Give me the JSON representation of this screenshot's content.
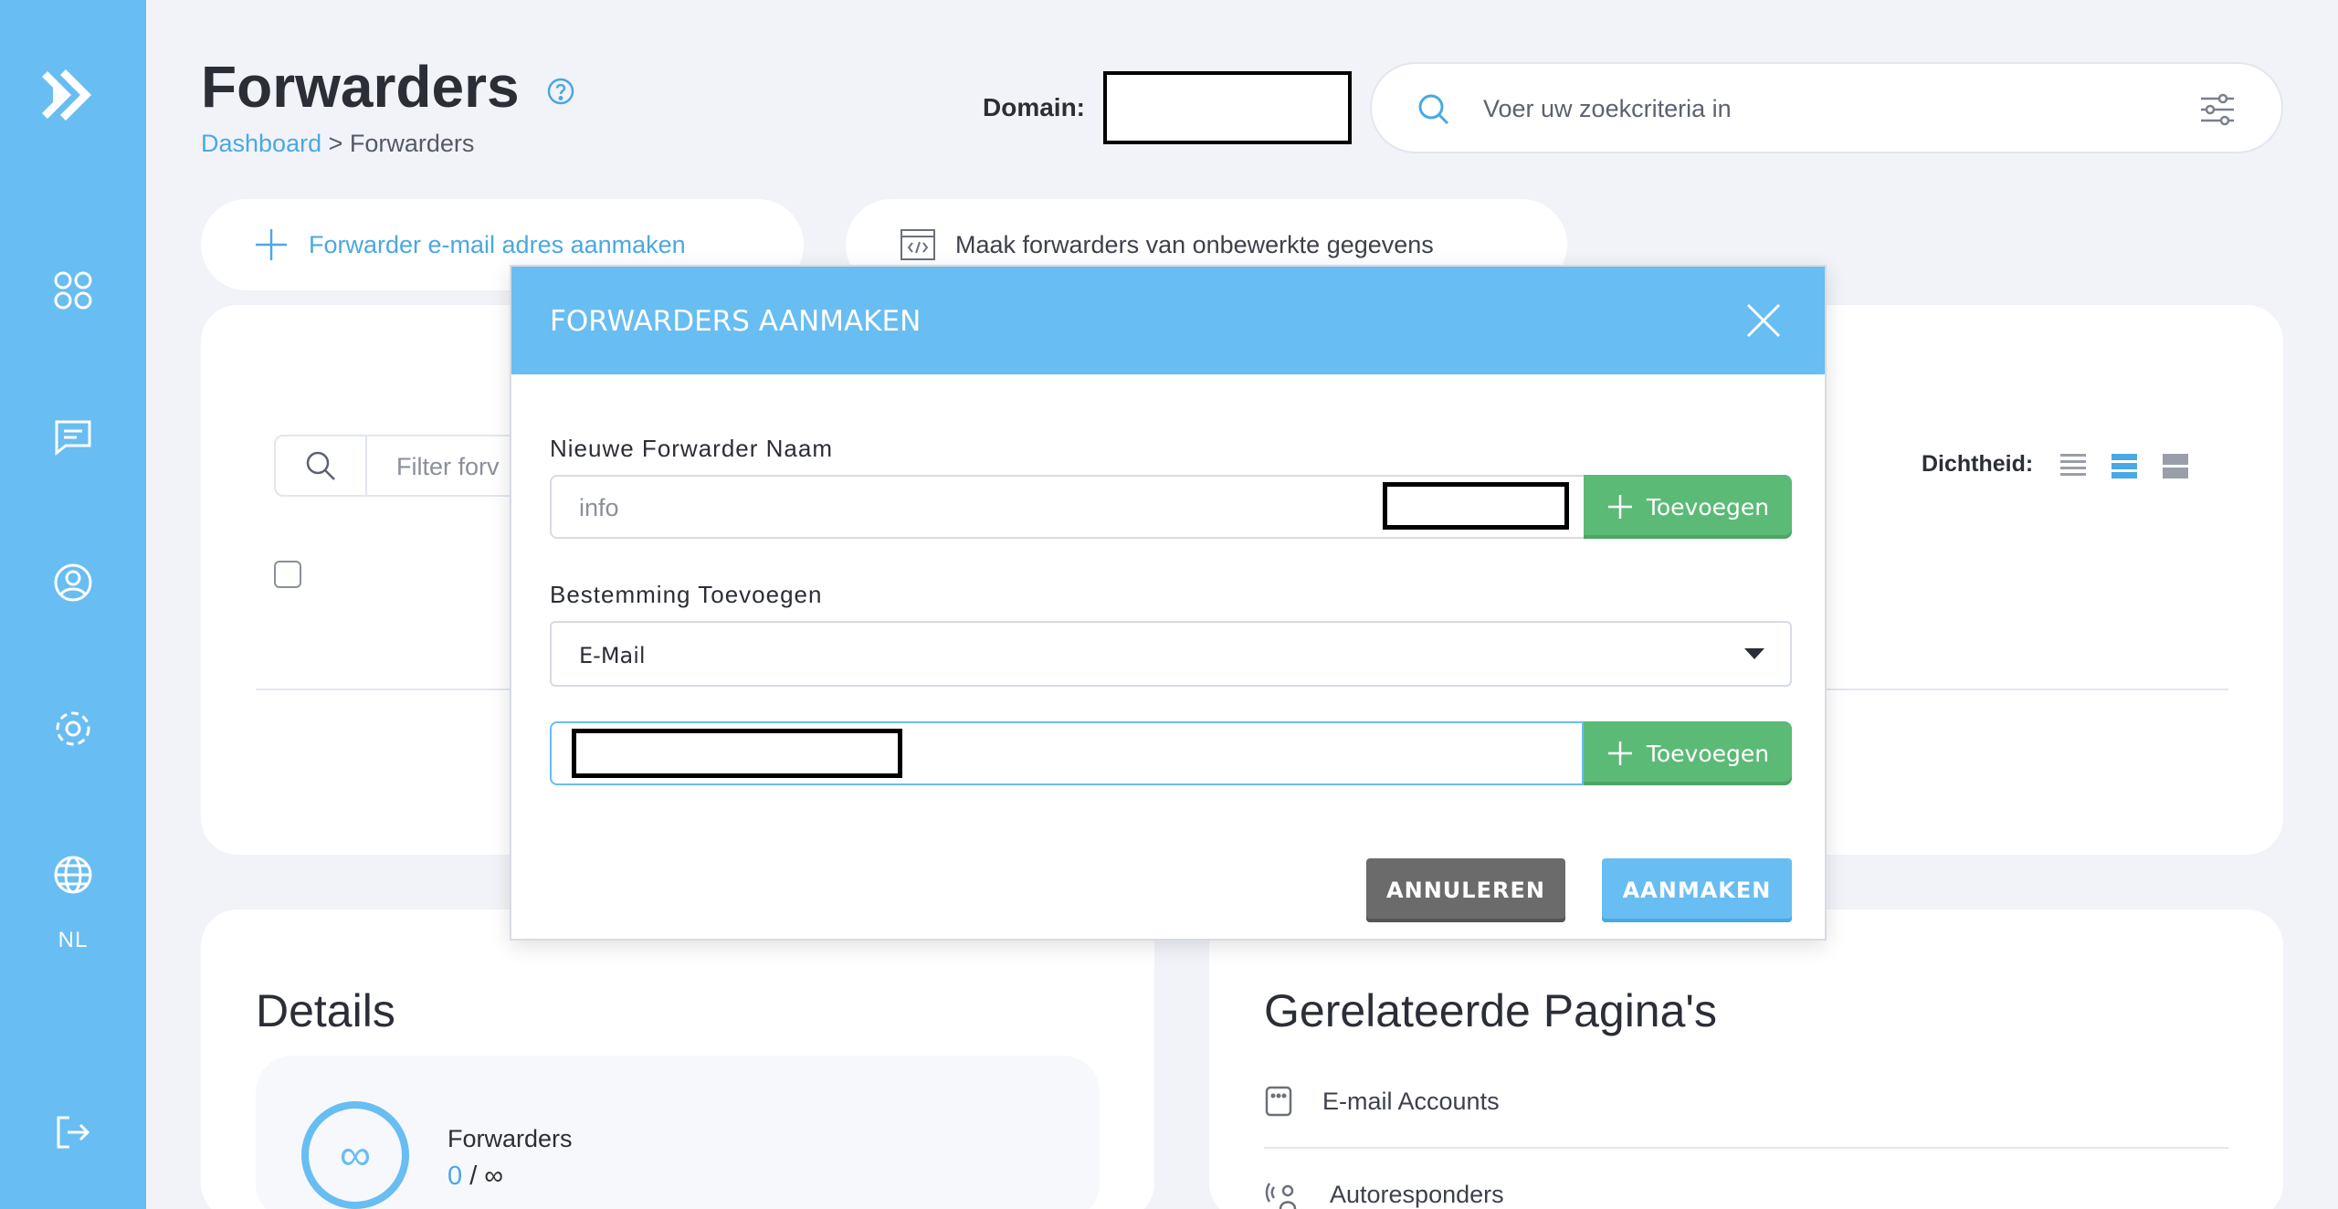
{
  "sidebar": {
    "language": "NL"
  },
  "header": {
    "title": "Forwarders",
    "breadcrumb_link": "Dashboard",
    "breadcrumb_sep": " > ",
    "breadcrumb_current": "Forwarders",
    "domain_label": "Domain:",
    "search_placeholder": "Voer uw zoekcriteria in"
  },
  "actions": {
    "create_forwarder": "Forwarder e-mail adres aanmaken",
    "create_raw": "Maak forwarders van onbewerkte gegevens"
  },
  "table": {
    "filter_placeholder": "Filter forv",
    "density_label": "Dichtheid:"
  },
  "details": {
    "title": "Details",
    "stat_label": "Forwarders",
    "stat_used": "0",
    "stat_sep": " / ",
    "stat_limit": "∞",
    "stat_icon": "∞"
  },
  "related": {
    "title": "Gerelateerde Pagina's",
    "items": [
      {
        "label": "E-mail Accounts"
      },
      {
        "label": "Autoresponders"
      }
    ]
  },
  "modal": {
    "title": "FORWARDERS AANMAKEN",
    "name_label": "Nieuwe Forwarder Naam",
    "name_value": "info",
    "add_label": "Toevoegen",
    "dest_label": "Bestemming Toevoegen",
    "dest_type": "E-Mail",
    "add_label_2": "Toevoegen",
    "cancel_label": "ANNULEREN",
    "create_label": "AANMAKEN"
  },
  "colors": {
    "accent": "#68bdf2",
    "success": "#5cba77",
    "neutral_button": "#6b6b6b",
    "background": "#f1f3f8"
  }
}
